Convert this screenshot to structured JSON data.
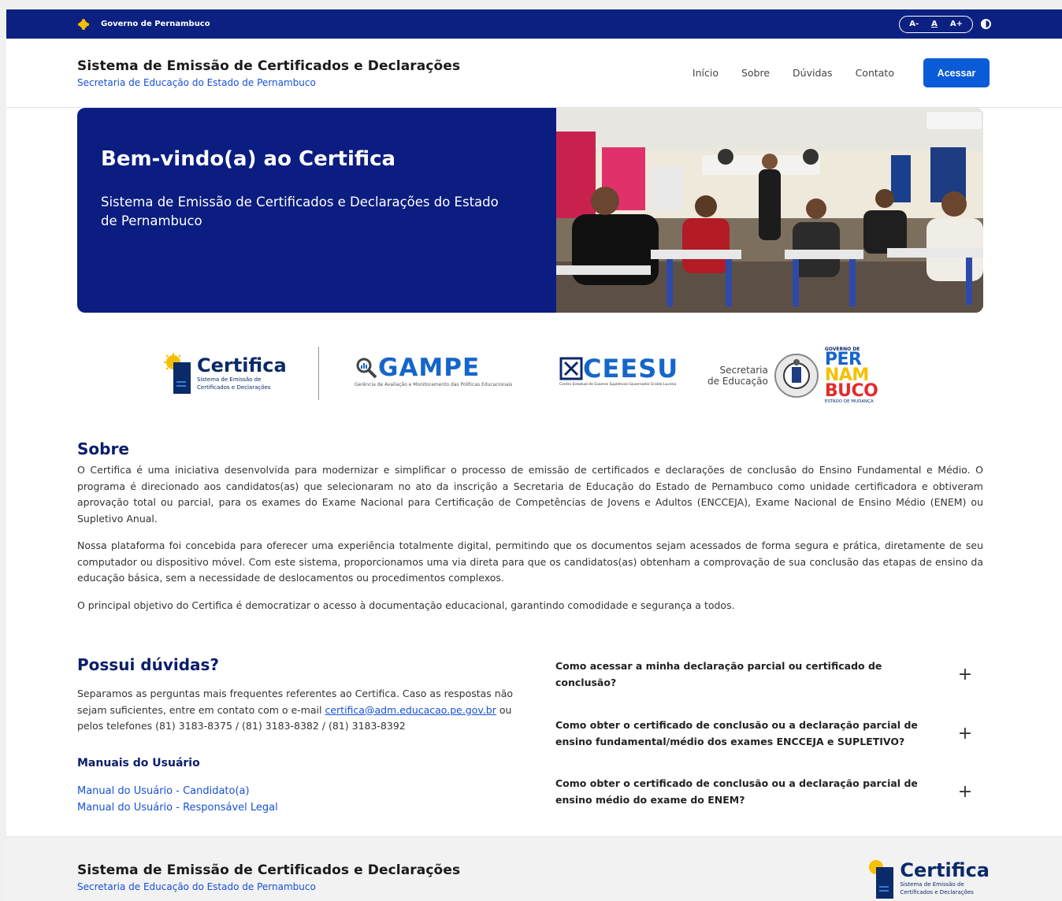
{
  "govbar": {
    "label": "Governo de Pernambuco",
    "font_decrease": "A-",
    "font_reset": "A",
    "font_increase": "A+"
  },
  "header": {
    "title": "Sistema de Emissão de Certificados e Declarações",
    "subtitle": "Secretaria de Educação do Estado de Pernambuco",
    "nav": [
      "Início",
      "Sobre",
      "Dúvidas",
      "Contato"
    ],
    "cta": "Acessar"
  },
  "hero": {
    "title": "Bem-vindo(a) ao Certifica",
    "subtitle": "Sistema de Emissão de Certificados e Declarações do Estado de Pernambuco"
  },
  "logos": {
    "certifica": {
      "name": "Certifica",
      "tagline_1": "Sistema de Emissão de",
      "tagline_2": "Certificados e Declarações"
    },
    "gampe": {
      "name": "GAMPE",
      "tagline": "Gerência de Avaliação e Monitoramento das Políticas Educacionais"
    },
    "ceesu": {
      "name": "CEESU",
      "tagline": "Centro Estadual de Exames Supletivos Governador Eraldo Lucena"
    },
    "secretaria": {
      "line1": "Secretaria",
      "line2": "de Educação",
      "gov": "GOVERNO DE",
      "p1": "PER",
      "p2": "NAM",
      "p3": "BUCO",
      "motto": "ESTADO DE MUDANÇA"
    }
  },
  "sobre": {
    "title": "Sobre",
    "p1": "O Certifica é uma iniciativa desenvolvida para modernizar e simplificar o processo de emissão de certificados e declarações de conclusão do Ensino Fundamental e Médio. O programa é direcionado aos candidatos(as) que selecionaram no ato da inscrição a Secretaria de Educação do Estado de Pernambuco como unidade certificadora e obtiveram aprovação total ou parcial, para os exames do Exame Nacional para Certificação de Competências de Jovens e Adultos (ENCCEJA), Exame Nacional de Ensino Médio (ENEM) ou Supletivo Anual.",
    "p2": "Nossa plataforma foi concebida para oferecer uma experiência totalmente digital, permitindo que os documentos sejam acessados de forma segura e prática, diretamente de seu computador ou dispositivo móvel. Com este sistema, proporcionamos uma via direta para que os candidatos(as) obtenham a comprovação de sua conclusão das etapas de ensino da educação básica, sem a necessidade de deslocamentos ou procedimentos complexos.",
    "p3": "O principal objetivo do Certifica é democratizar o acesso à documentação educacional, garantindo comodidade e segurança a todos."
  },
  "duvidas": {
    "title": "Possui dúvidas?",
    "text_before": "Separamos as perguntas mais frequentes referentes ao Certifica. Caso as respostas não sejam suficientes, entre em contato com o e-mail ",
    "email": "certifica@adm.educacao.pe.gov.br",
    "text_after": " ou pelos telefones (81) 3183-8375 / (81) 3183-8382 / (81) 3183-8392",
    "manuais_title": "Manuais do Usuário",
    "manuais": [
      "Manual do Usuário - Candidato(a)",
      "Manual do Usuário - Responsável Legal"
    ],
    "faq": [
      "Como acessar a minha declaração parcial ou certificado de conclusão?",
      "Como obter o certificado de conclusão ou a declaração parcial de ensino fundamental/médio dos exames ENCCEJA e SUPLETIVO?",
      "Como obter o certificado de conclusão ou a declaração parcial de ensino médio do exame do ENEM?"
    ],
    "expand_symbol": "+"
  },
  "footer": {
    "title": "Sistema de Emissão de Certificados e Declarações",
    "subtitle": "Secretaria de Educação do Estado de Pernambuco"
  },
  "colors": {
    "navy": "#0b1d80",
    "primary_blue": "#0a5bd8",
    "link_blue": "#1750d8",
    "sun_yellow": "#f6c000"
  }
}
